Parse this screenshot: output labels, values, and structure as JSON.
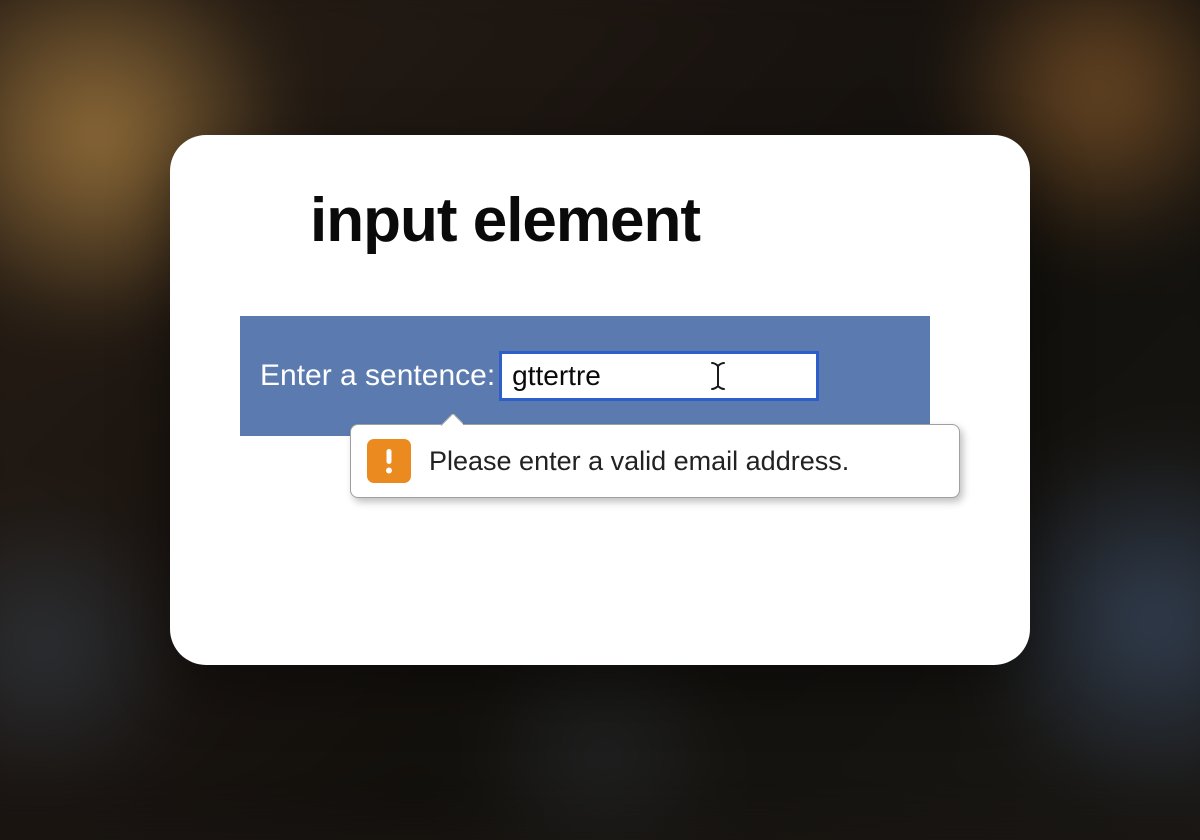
{
  "heading": "input element",
  "form": {
    "label": "Enter a sentence:",
    "input_value": "gttertre"
  },
  "validation": {
    "message": "Please enter a valid email address.",
    "icon_name": "warning-exclamation"
  },
  "colors": {
    "form_bg": "#5b7bb0",
    "input_border": "#2d5ec9",
    "warn_badge": "#ea8a1f"
  }
}
